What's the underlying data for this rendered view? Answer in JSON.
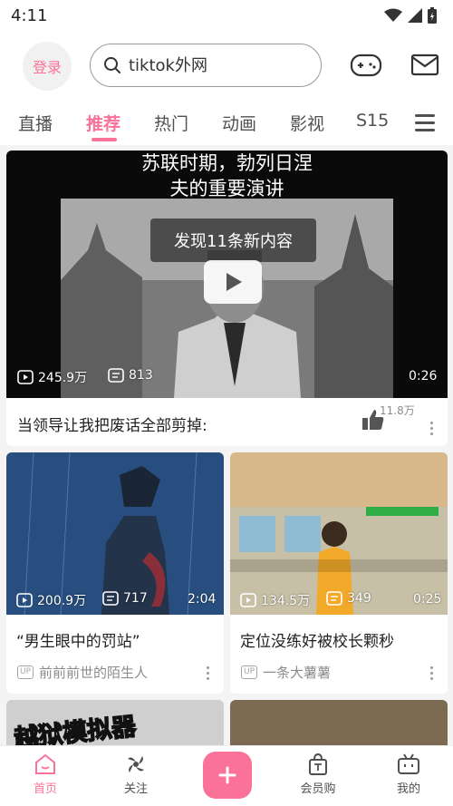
{
  "status": {
    "time": "4:11"
  },
  "header": {
    "login_label": "登录",
    "search_placeholder": "tiktok外网"
  },
  "tabs": [
    {
      "label": "直播"
    },
    {
      "label": "推荐",
      "active": true
    },
    {
      "label": "热门"
    },
    {
      "label": "动画"
    },
    {
      "label": "影视"
    },
    {
      "label": "S15"
    }
  ],
  "feed": {
    "featured": {
      "overlay_text_line1": "苏联时期，勃列日涅",
      "overlay_text_line2": "夫的重要演讲",
      "toast": "发现11条新内容",
      "views": "245.9万",
      "danmaku": "813",
      "duration": "0:26",
      "title": "当领导让我把废话全部剪掉:",
      "likes": "11.8万"
    },
    "cards": [
      {
        "views": "200.9万",
        "danmaku": "717",
        "duration": "2:04",
        "title": "“男生眼中的罚站”",
        "badge": "UP",
        "author": "前前前世的陌生人"
      },
      {
        "views": "134.5万",
        "danmaku": "349",
        "duration": "0:25",
        "title": "定位没练好被校长颗秒",
        "badge": "UP",
        "author": "一条大薯薯"
      }
    ],
    "partial_card_text": "越狱模拟器"
  },
  "bottom_nav": [
    {
      "label": "首页",
      "active": true
    },
    {
      "label": "关注"
    },
    {
      "label": "会员购"
    },
    {
      "label": "我的"
    }
  ],
  "colors": {
    "accent": "#fb7299"
  }
}
